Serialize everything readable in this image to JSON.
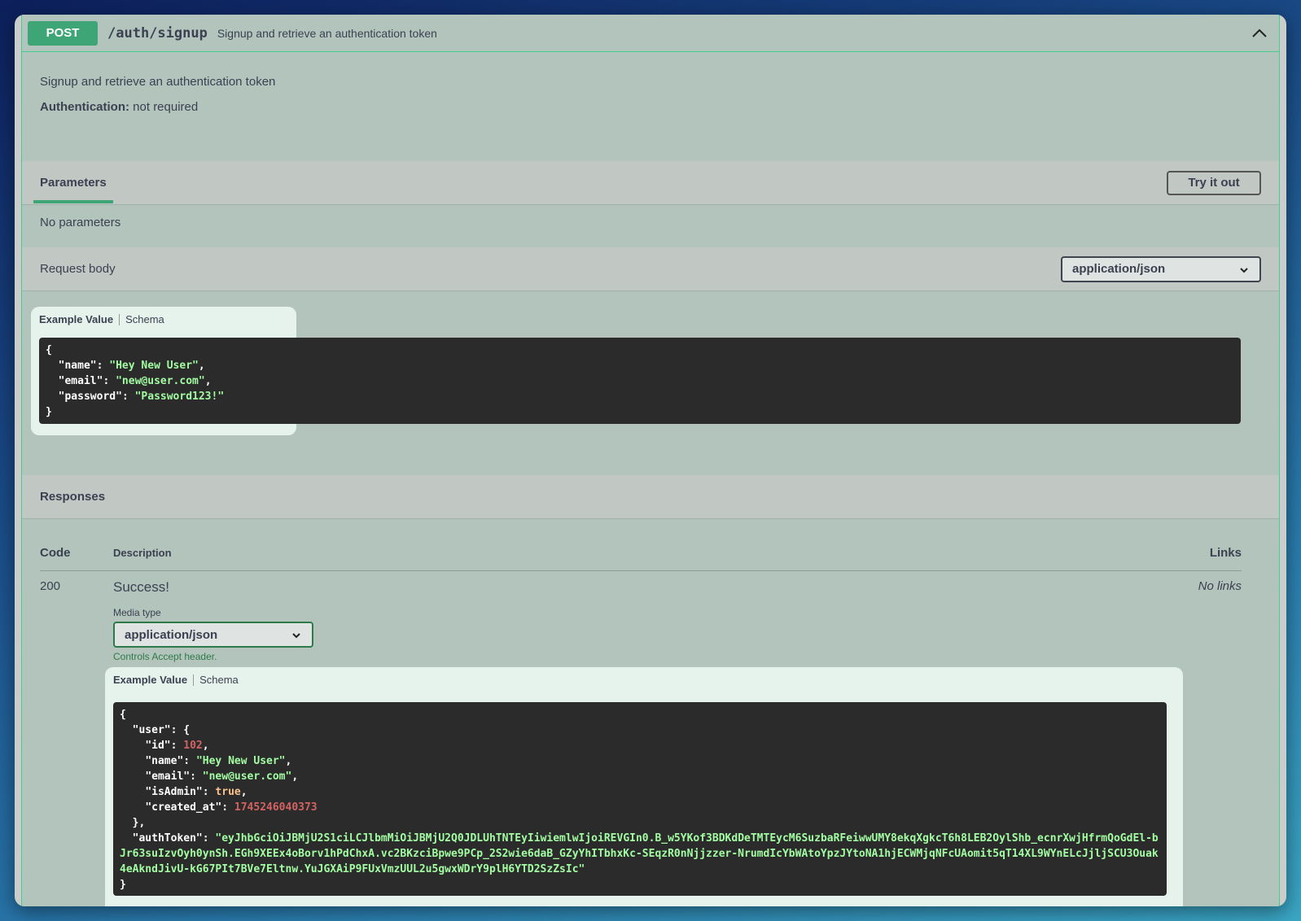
{
  "endpoint": {
    "method": "POST",
    "path": "/auth/signup",
    "summary": "Signup and retrieve an authentication token"
  },
  "description": {
    "text": "Signup and retrieve an authentication token",
    "auth_label": "Authentication:",
    "auth_value": "not required"
  },
  "parameters": {
    "tab_label": "Parameters",
    "try_button": "Try it out",
    "empty_text": "No parameters"
  },
  "request_body": {
    "label": "Request body",
    "content_type": "application/json",
    "tabs": {
      "example": "Example Value",
      "schema": "Schema"
    },
    "example": {
      "open": "{",
      "name_key": "\"name\"",
      "name_val": "\"Hey New User\"",
      "email_key": "\"email\"",
      "email_val": "\"new@user.com\"",
      "password_key": "\"password\"",
      "password_val": "\"Password123!\"",
      "close": "}"
    }
  },
  "responses": {
    "label": "Responses",
    "columns": {
      "code": "Code",
      "description": "Description",
      "links": "Links"
    },
    "rows": [
      {
        "code": "200",
        "description": "Success!",
        "links": "No links",
        "media_type_label": "Media type",
        "media_type": "application/json",
        "controls_note": "Controls Accept header.",
        "tabs": {
          "example": "Example Value",
          "schema": "Schema"
        },
        "example": {
          "user_key": "\"user\"",
          "id_key": "\"id\"",
          "id_val": "102",
          "name_key": "\"name\"",
          "name_val": "\"Hey New User\"",
          "email_key": "\"email\"",
          "email_val": "\"new@user.com\"",
          "isAdmin_key": "\"isAdmin\"",
          "isAdmin_val": "true",
          "created_key": "\"created_at\"",
          "created_val": "1745246040373",
          "token_key": "\"authToken\"",
          "token_val": "\"eyJhbGciOiJBMjU2S1ciLCJlbmMiOiJBMjU2Q0JDLUhTNTEyIiwiemlwIjoiREVGIn0.B_w5YKof3BDKdDeTMTEycM6SuzbaRFeiwwUMY8ekqXgkcT6h8LEB2OylShb_ecnrXwjHfrmQoGdEl-bJr63suIzvOyh0ynSh.EGh9XEEx4oBorv1hPdChxA.vc2BKzciBpwe9PCp_2S2wie6daB_GZyYhITbhxKc-SEqzR0nNjjzzer-NrumdIcYbWAtoYpzJYtoNA1hjECWMjqNFcUAomit5qT14XL9WYnELcJjljSCU3Ouak4eAkndJivU-kG67PIt7BVe7Eltnw.YuJGXAiP9FUxVmzUUL2u5gwxWDrY9plH6YTD2SzZsIc\""
        }
      }
    ]
  },
  "colors": {
    "post_method": "#3ea676",
    "border_accent": "#49cc90",
    "code_bg": "#2b2b2b",
    "string": "#a2fca2",
    "number": "#d36363",
    "boolean": "#fcc28c"
  }
}
